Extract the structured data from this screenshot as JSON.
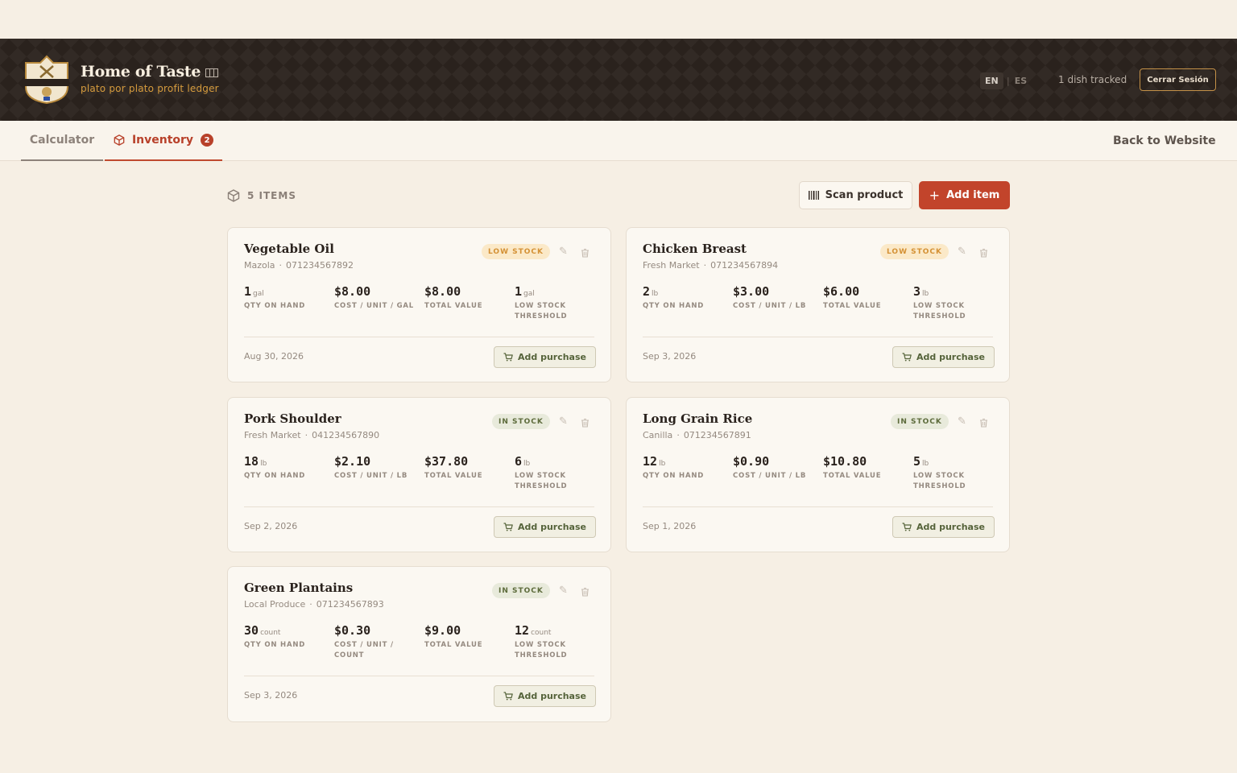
{
  "header": {
    "brand_title": "Home of Taste",
    "brand_subtitle": "plato por plato profit ledger",
    "lang_en": "EN",
    "lang_es": "ES",
    "dishes_tracked": "1 dish tracked",
    "logout_label": "Cerrar Sesión"
  },
  "tabs": {
    "calculator": "Calculator",
    "inventory": "Inventory",
    "inventory_badge": "2",
    "back_link": "Back to Website"
  },
  "toolbar": {
    "items_count": "5 ITEMS",
    "scan_label": "Scan product",
    "add_label": "Add item"
  },
  "labels": {
    "qty_on_hand": "QTY ON HAND",
    "total_value": "TOTAL VALUE",
    "low_stock_threshold": "LOW STOCK THRESHOLD",
    "add_purchase": "Add purchase"
  },
  "items": [
    {
      "name": "Vegetable Oil",
      "brand": "Mazola",
      "code": "071234567892",
      "status": "LOW STOCK",
      "status_type": "low",
      "qty": "1",
      "qty_unit": "gal",
      "cost": "$8.00",
      "cost_label": "COST / UNIT / GAL",
      "total": "$8.00",
      "threshold": "1",
      "threshold_unit": "gal",
      "date": "Aug 30, 2026"
    },
    {
      "name": "Chicken Breast",
      "brand": "Fresh Market",
      "code": "071234567894",
      "status": "LOW STOCK",
      "status_type": "low",
      "qty": "2",
      "qty_unit": "lb",
      "cost": "$3.00",
      "cost_label": "COST / UNIT / LB",
      "total": "$6.00",
      "threshold": "3",
      "threshold_unit": "lb",
      "date": "Sep 3, 2026"
    },
    {
      "name": "Pork Shoulder",
      "brand": "Fresh Market",
      "code": "041234567890",
      "status": "IN STOCK",
      "status_type": "in",
      "qty": "18",
      "qty_unit": "lb",
      "cost": "$2.10",
      "cost_label": "COST / UNIT / LB",
      "total": "$37.80",
      "threshold": "6",
      "threshold_unit": "lb",
      "date": "Sep 2, 2026"
    },
    {
      "name": "Long Grain Rice",
      "brand": "Canilla",
      "code": "071234567891",
      "status": "IN STOCK",
      "status_type": "in",
      "qty": "12",
      "qty_unit": "lb",
      "cost": "$0.90",
      "cost_label": "COST / UNIT / LB",
      "total": "$10.80",
      "threshold": "5",
      "threshold_unit": "lb",
      "date": "Sep 1, 2026"
    },
    {
      "name": "Green Plantains",
      "brand": "Local Produce",
      "code": "071234567893",
      "status": "IN STOCK",
      "status_type": "in",
      "qty": "30",
      "qty_unit": "count",
      "cost": "$0.30",
      "cost_label": "COST / UNIT / COUNT",
      "total": "$9.00",
      "threshold": "12",
      "threshold_unit": "count",
      "date": "Sep 3, 2026"
    }
  ],
  "colors": {
    "accent": "#c2442b",
    "header_bg": "#2a221d",
    "page_bg": "#f6efe4",
    "low_stock": "#d49135",
    "in_stock": "#5d6b3b"
  }
}
